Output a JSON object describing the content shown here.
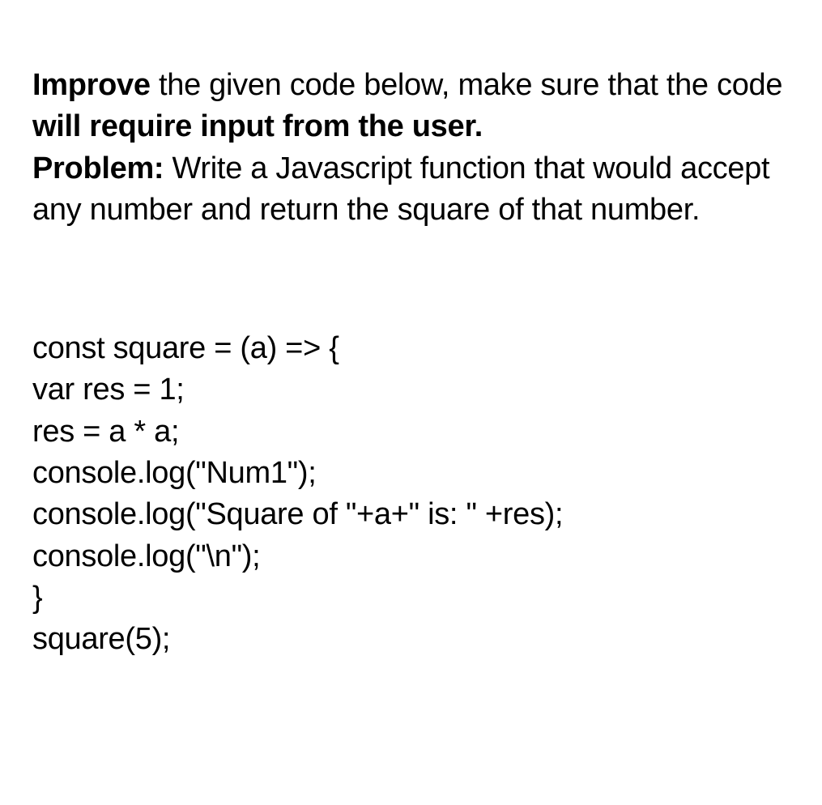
{
  "intro": {
    "word_improve": "Improve",
    "text_after_improve": " the given code below, make sure that the code ",
    "word_require": "will require input from the user.",
    "word_problem": "Problem:",
    "text_after_problem": " Write a Javascript function that would accept any number and return the square of that number."
  },
  "code": {
    "line1": "const square = (a) => {",
    "line2": "var res = 1;",
    "line3": "res = a * a;",
    "line4": "console.log(\"Num1\");",
    "line5": "console.log(\"Square of \"+a+\" is: \" +res);",
    "line6": "console.log(\"\\n\");",
    "line7": "}",
    "line8": "square(5);"
  }
}
